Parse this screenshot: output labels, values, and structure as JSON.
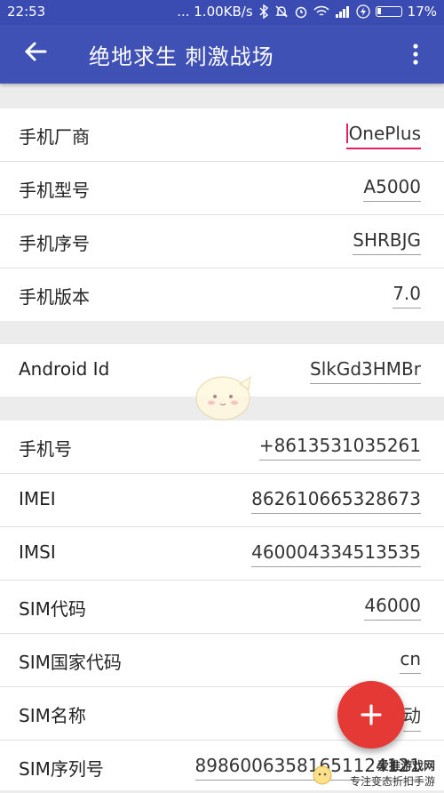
{
  "status_bar": {
    "time": "22:53",
    "network_speed": "... 1.00KB/s",
    "battery": "17%"
  },
  "app_bar": {
    "title": "绝地求生 刺激战场",
    "back_icon": "arrow-back-icon",
    "more_icon": "more-vert-icon"
  },
  "device_group": [
    {
      "label": "手机厂商",
      "value": "OnePlus",
      "focused": true
    },
    {
      "label": "手机型号",
      "value": "A5000"
    },
    {
      "label": "手机序号",
      "value": "SHRBJG"
    },
    {
      "label": "手机版本",
      "value": "7.0"
    }
  ],
  "android_group": [
    {
      "label": "Android Id",
      "value": "SlkGd3HMBr"
    }
  ],
  "sim_group": [
    {
      "label": "手机号",
      "value": "+8613531035261"
    },
    {
      "label": "IMEI",
      "value": "862610665328673"
    },
    {
      "label": "IMSI",
      "value": "460004334513535"
    },
    {
      "label": "SIM代码",
      "value": "46000"
    },
    {
      "label": "SIM国家代码",
      "value": "cn"
    },
    {
      "label": "SIM名称",
      "value": "动"
    },
    {
      "label": "SIM序列号",
      "value": "89860063581651124121"
    }
  ],
  "fab": {
    "icon": "plus-icon"
  },
  "watermark": {
    "site": "爱推游戏网",
    "slogan": "专注变态折扣手游"
  },
  "colors": {
    "primary": "#3f51b5",
    "primary_dark": "#3a4cb2",
    "accent": "#e91e63",
    "fab": "#e53935"
  }
}
